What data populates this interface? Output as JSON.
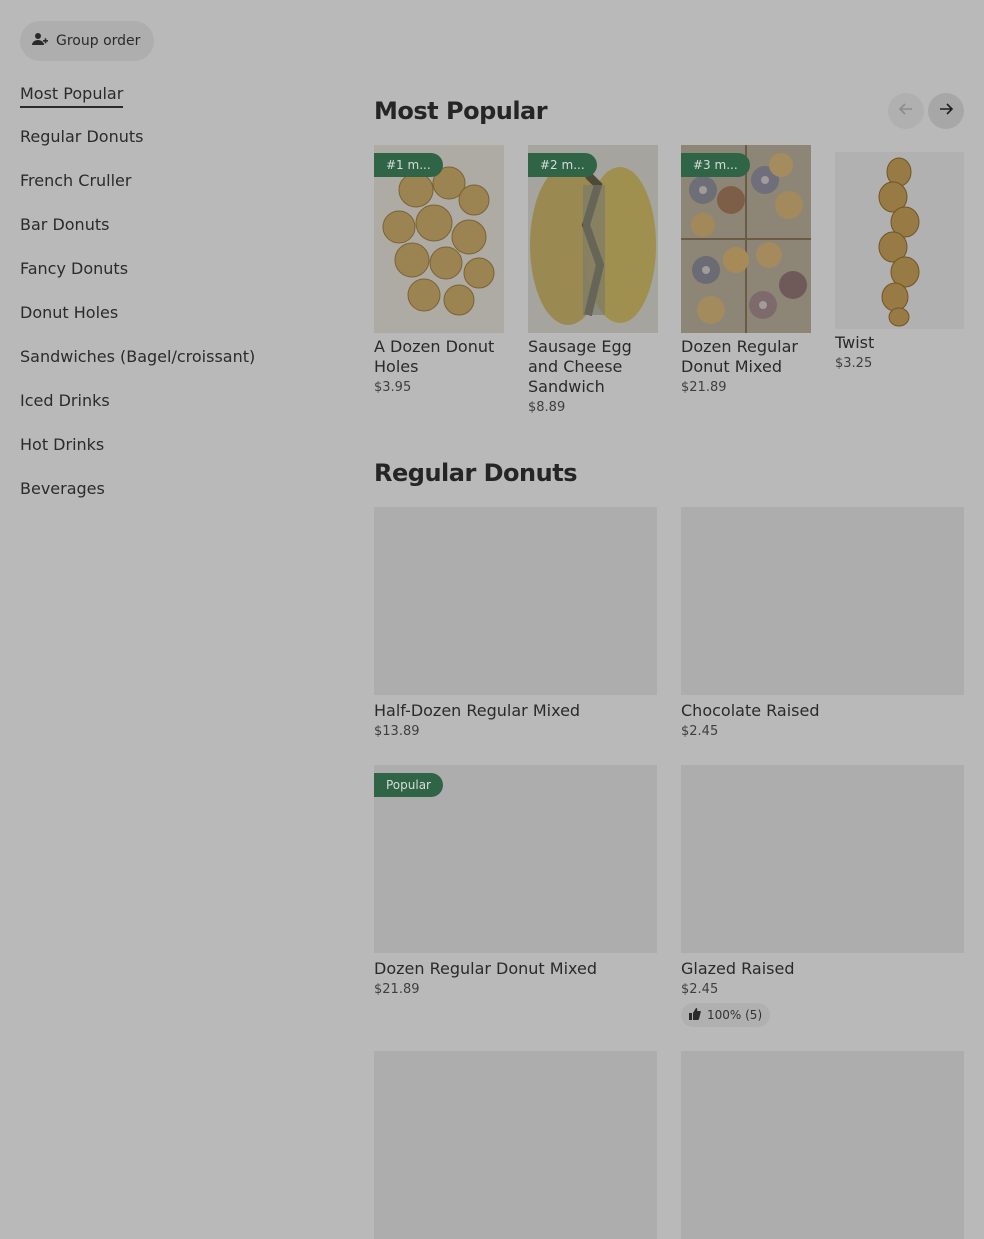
{
  "group_order": {
    "label": "Group order"
  },
  "nav": [
    "Most Popular",
    "Regular Donuts",
    "French Cruller",
    "Bar Donuts",
    "Fancy Donuts",
    "Donut Holes",
    "Sandwiches (Bagel/croissant)",
    "Iced Drinks",
    "Hot Drinks",
    "Beverages"
  ],
  "most_popular": {
    "title": "Most Popular",
    "items": [
      {
        "badge": "#1 m...",
        "name": "A Dozen Donut Holes",
        "price": "$3.95"
      },
      {
        "badge": "#2 m...",
        "name": "Sausage Egg and Cheese Sandwich",
        "price": "$8.89"
      },
      {
        "badge": "#3 m...",
        "name": "Dozen Regular Donut Mixed",
        "price": "$21.89"
      },
      {
        "badge": "",
        "name": "Twist",
        "price": "$3.25"
      }
    ]
  },
  "regular": {
    "title": "Regular Donuts",
    "items": [
      {
        "name": "Half-Dozen Regular Mixed",
        "price": "$13.89",
        "badge": "",
        "rating": ""
      },
      {
        "name": "Chocolate Raised",
        "price": "$2.45",
        "badge": "",
        "rating": ""
      },
      {
        "name": "Dozen Regular Donut Mixed",
        "price": "$21.89",
        "badge": "Popular",
        "rating": ""
      },
      {
        "name": "Glazed Raised",
        "price": "$2.45",
        "badge": "",
        "rating": "100% (5)"
      }
    ]
  },
  "colors": {
    "badge_bg": "#2f6447",
    "overlay_bg": "#b9b9b9"
  }
}
